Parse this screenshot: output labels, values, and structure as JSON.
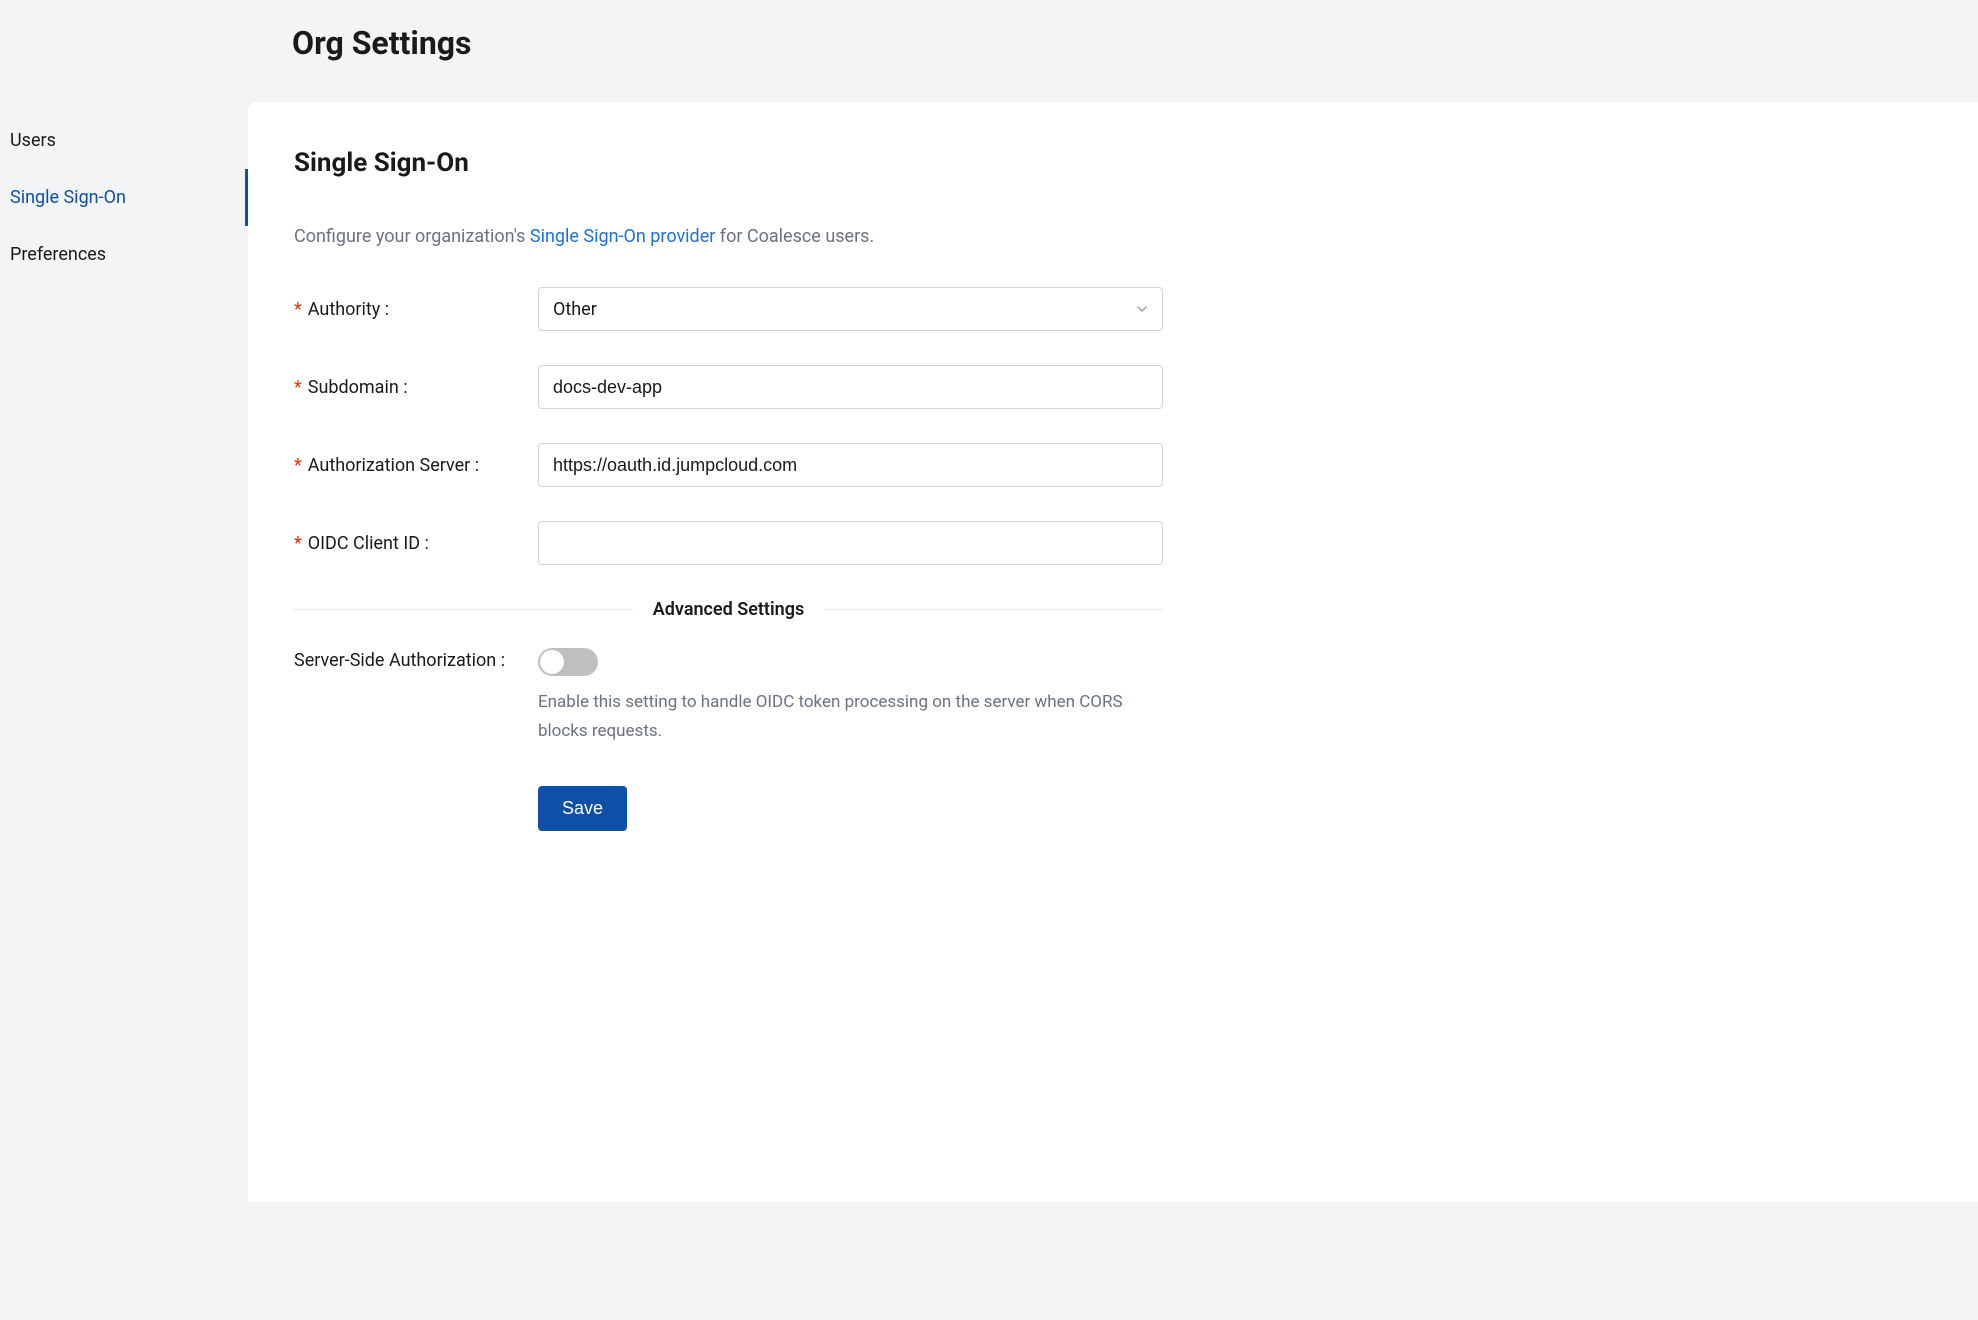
{
  "page_title": "Org Settings",
  "sidebar": {
    "items": [
      {
        "label": "Users",
        "active": false
      },
      {
        "label": "Single Sign-On",
        "active": true
      },
      {
        "label": "Preferences",
        "active": false
      }
    ]
  },
  "content": {
    "section_title": "Single Sign-On",
    "description_prefix": "Configure your organization's ",
    "description_link": "Single Sign-On provider",
    "description_suffix": " for Coalesce users.",
    "form": {
      "authority": {
        "label": "Authority",
        "required": true,
        "value": "Other"
      },
      "subdomain": {
        "label": "Subdomain",
        "required": true,
        "value": "docs-dev-app"
      },
      "authorization_server": {
        "label": "Authorization Server",
        "required": true,
        "value": "https://oauth.id.jumpcloud.com"
      },
      "oidc_client_id": {
        "label": "OIDC Client ID",
        "required": true,
        "value": ""
      }
    },
    "advanced_title": "Advanced Settings",
    "server_side_auth": {
      "label": "Server-Side Authorization",
      "enabled": false,
      "help": "Enable this setting to handle OIDC token processing on the server when CORS blocks requests."
    },
    "save_label": "Save"
  }
}
